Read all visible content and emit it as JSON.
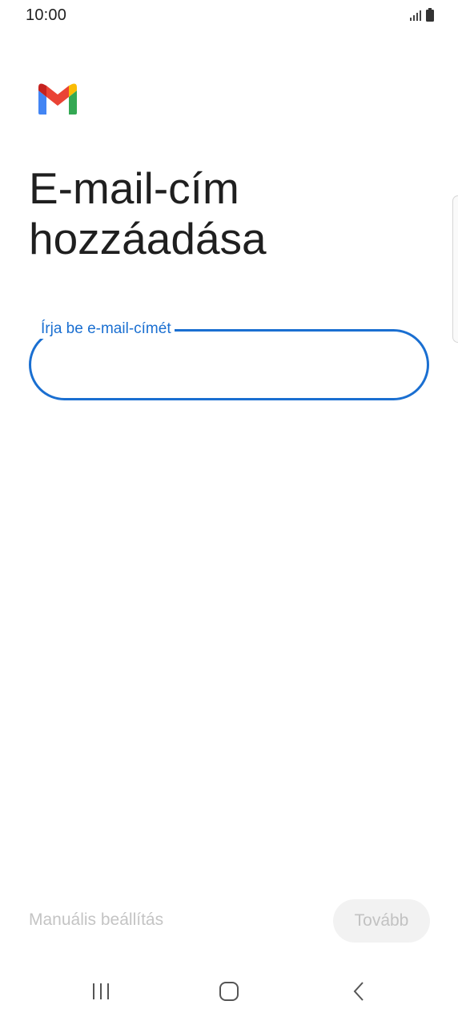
{
  "status_bar": {
    "time": "10:00"
  },
  "app": {
    "logo": "gmail-logo",
    "title": "E-mail-cím hozzáadása"
  },
  "email_field": {
    "label": "Írja be e-mail-címét",
    "value": "",
    "accent_color": "#1a6fd1"
  },
  "actions": {
    "manual_setup": "Manuális beállítás",
    "next": "Tovább"
  },
  "nav_bar": {
    "icons": [
      "recents-icon",
      "home-icon",
      "back-icon"
    ]
  }
}
